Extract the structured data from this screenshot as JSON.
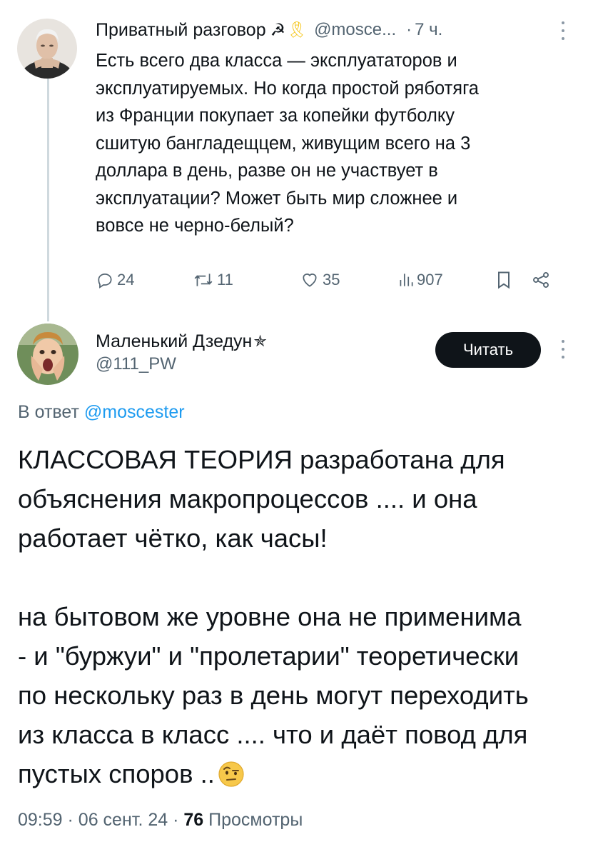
{
  "parent_tweet": {
    "author_name": "Приватный разговор",
    "author_emoji_1": "☭",
    "author_emoji_2": "🎗",
    "author_handle": "@mosce...",
    "separator": "·",
    "time": "7 ч.",
    "text": "Есть всего два класса — эксплуататоров и\nэксплуатируемых. Но когда простой ряботяга\nиз Франции покупает за копейки футболку\nсшитую бангладещцем, живущим всего на 3\nдоллара в день, разве он не участвует в\nэксплуатации? Может быть мир сложнее и\nвовсе не черно-белый?",
    "stats": {
      "replies": "24",
      "retweets": "11",
      "likes": "35",
      "views": "907"
    }
  },
  "main_tweet": {
    "author_name": "Маленький Дзедун",
    "author_badge": "✯",
    "author_handle": "@111_PW",
    "follow_label": "Читать",
    "reply_prefix": "В ответ",
    "reply_handle": "@moscester",
    "paragraph_1": "КЛАССОВАЯ ТЕОРИЯ разработана для\nобъяснения макропроцессов .... и она\nработает чётко, как часы!",
    "paragraph_2": "на бытовом же уровне она не применима\n- и \"буржуи\" и \"пролетарии\" теоретически\nпо нескольку раз в день могут переходить\nиз класса в класс .... что и даёт повод для\nпустых споров ..",
    "emoji_name": "face-with-raised-eyebrow-icon",
    "time": "09:59",
    "separator": "·",
    "date": "06 сент. 24",
    "views_count": "76",
    "views_label": "Просмотры"
  },
  "colors": {
    "text": "#0f1419",
    "secondary": "#536471",
    "link": "#1d9bf0",
    "button_bg": "#0f1419",
    "thread_line": "#cfd9de"
  }
}
